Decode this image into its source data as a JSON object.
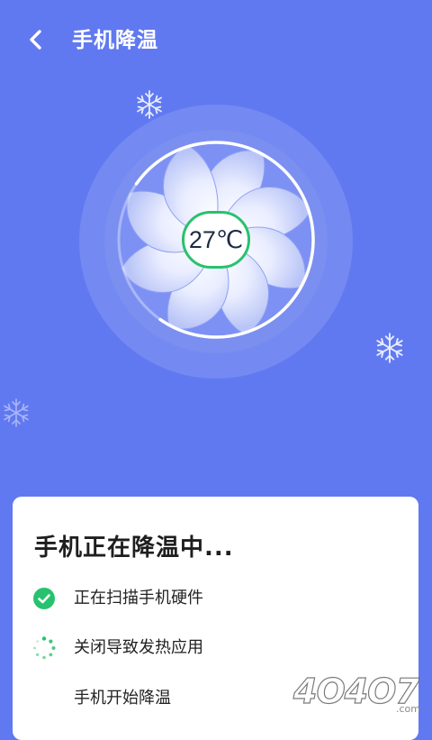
{
  "header": {
    "title": "手机降温",
    "back_icon": "back-chevron-icon"
  },
  "fan": {
    "temperature": "27℃",
    "progress_fraction": 0.75,
    "accent_color": "#27c26d"
  },
  "card": {
    "title": "手机正在降温中...",
    "steps": [
      {
        "label": "正在扫描手机硬件",
        "status": "done",
        "icon": "check-circle-icon"
      },
      {
        "label": "关闭导致发热应用",
        "status": "in-progress",
        "icon": "loading-spinner-icon"
      },
      {
        "label": "手机开始降温",
        "status": "pending",
        "icon": ""
      }
    ]
  },
  "colors": {
    "background": "#6179f0",
    "success": "#27c26d"
  },
  "watermark": {
    "text": "4O4O7",
    "suffix": ".com"
  }
}
